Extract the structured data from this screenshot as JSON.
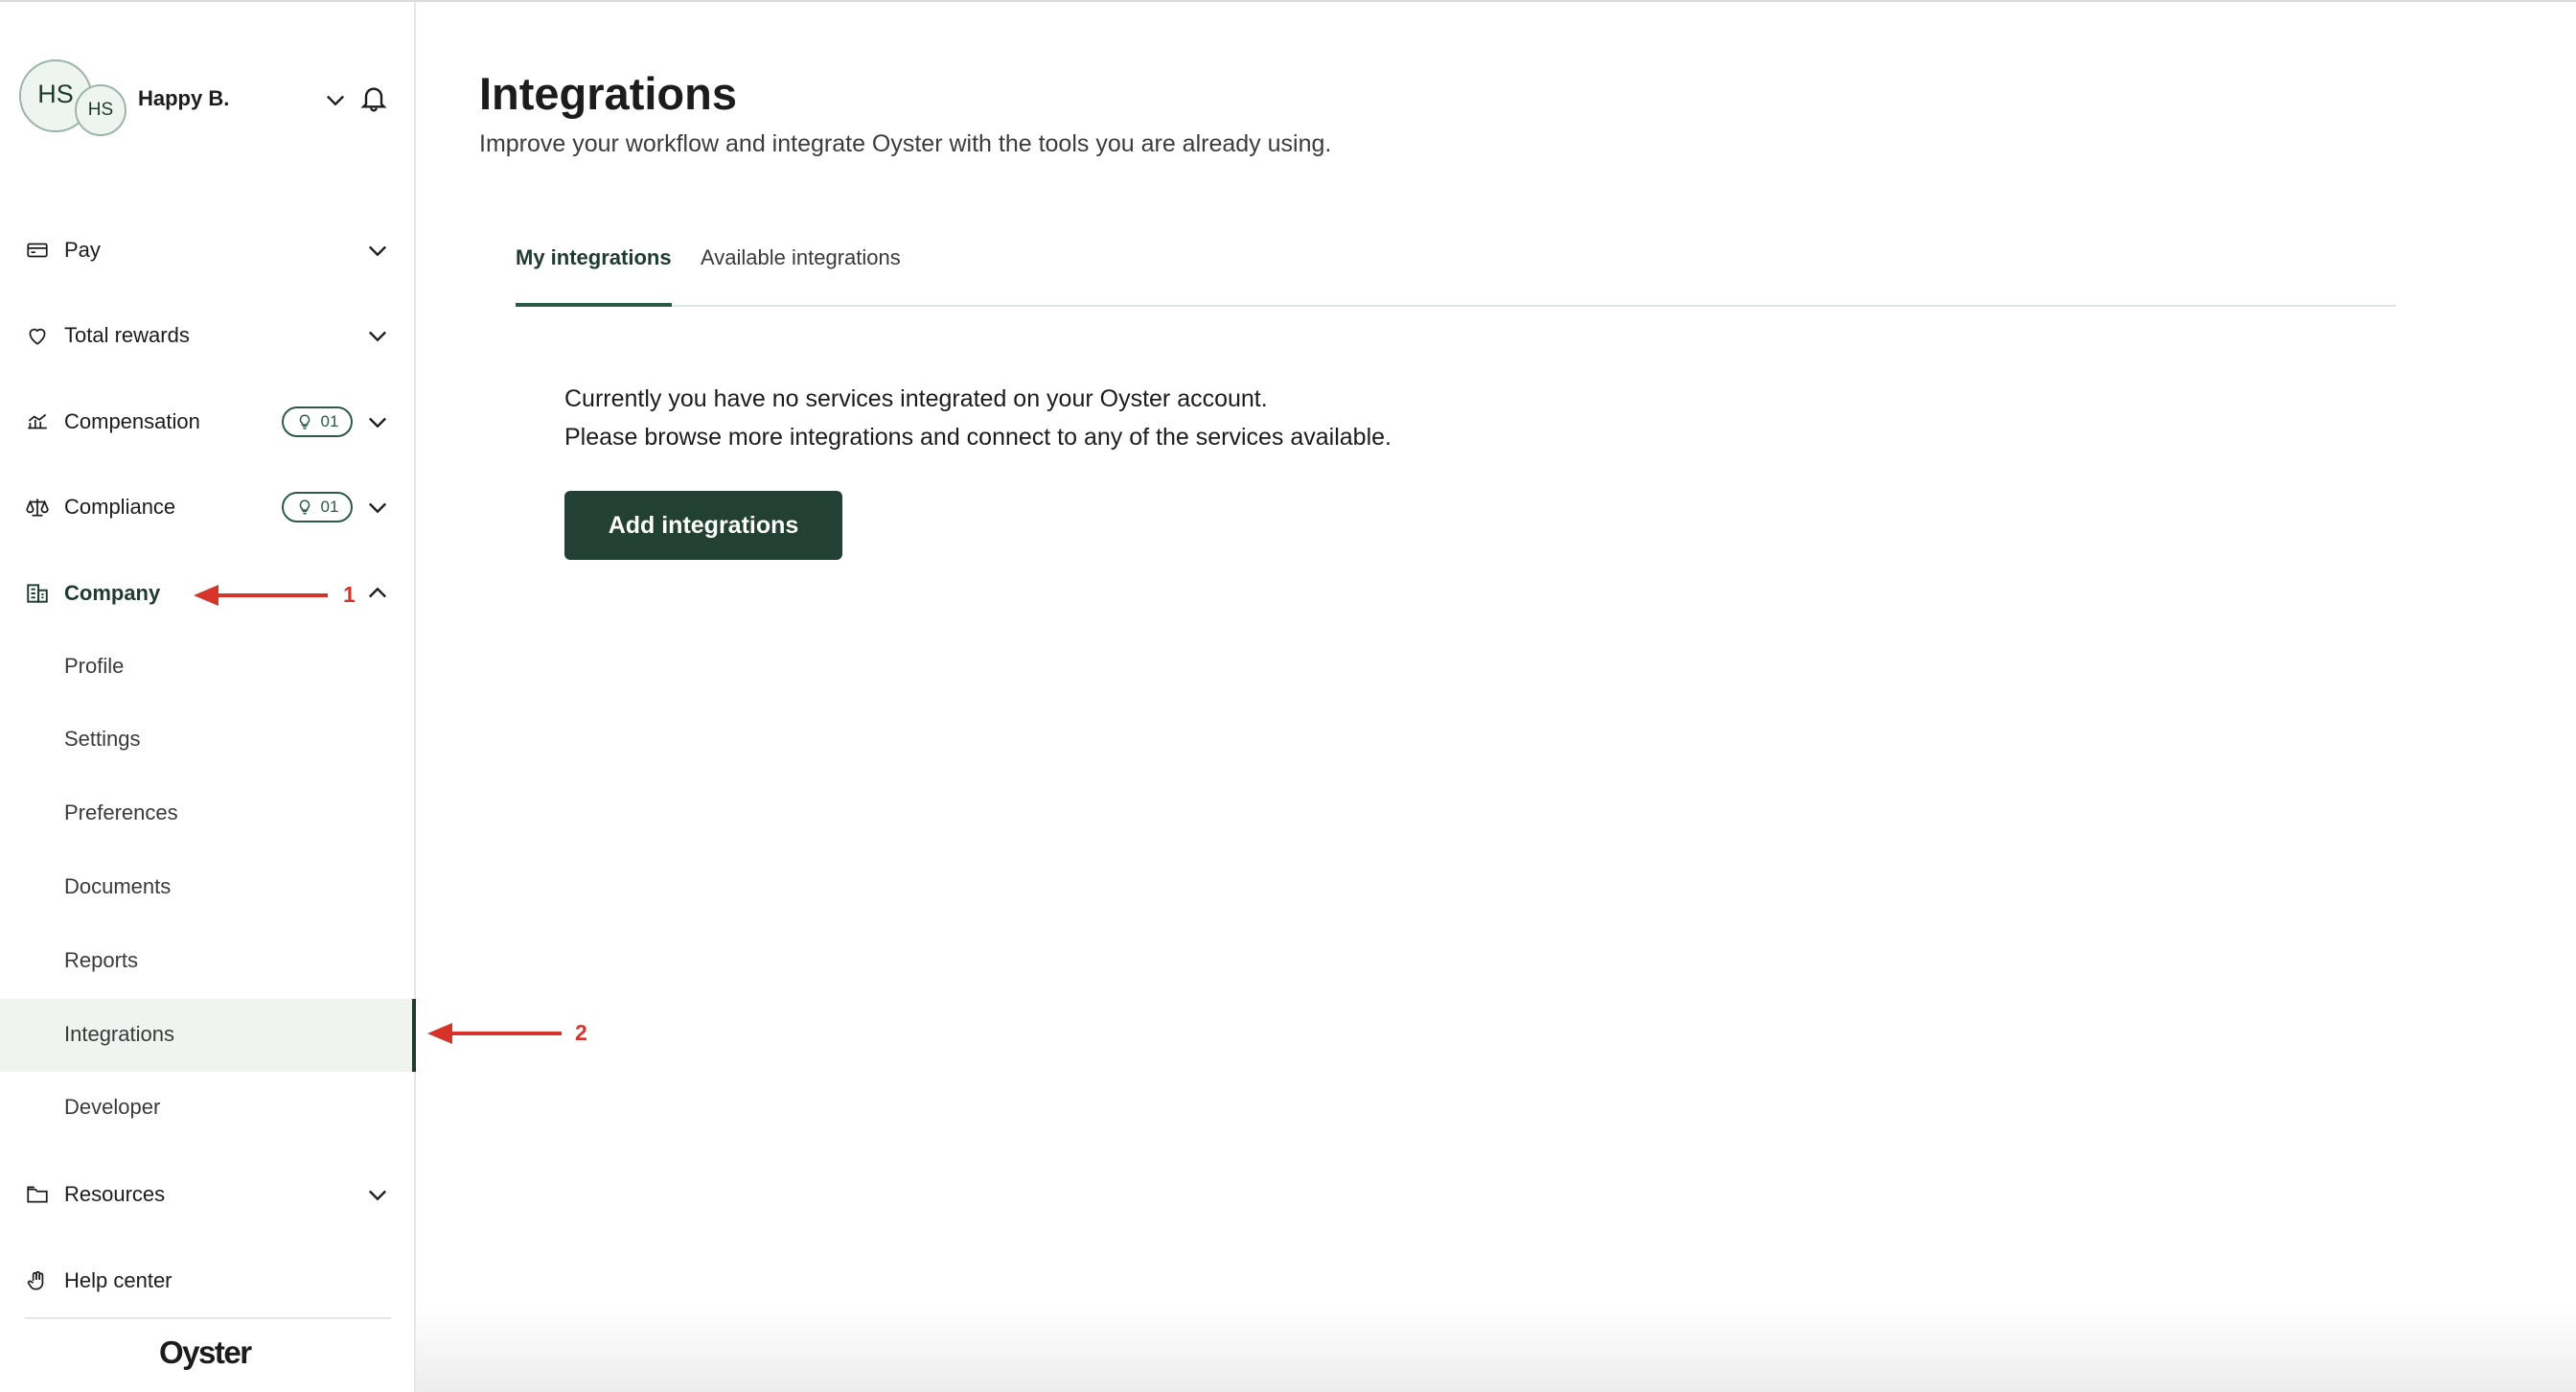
{
  "user": {
    "initials_primary": "HS",
    "initials_secondary": "HS",
    "name": "Happy B."
  },
  "nav": {
    "pay": "Pay",
    "total_rewards": "Total rewards",
    "compensation": "Compensation",
    "compensation_badge": "01",
    "compliance": "Compliance",
    "compliance_badge": "01",
    "company": "Company",
    "company_sub": [
      "Profile",
      "Settings",
      "Preferences",
      "Documents",
      "Reports",
      "Integrations",
      "Developer"
    ],
    "resources": "Resources",
    "help_center": "Help center"
  },
  "brand": {
    "logo_text": "Oyster",
    "accent": "#234034",
    "annotation_color": "#d6342b"
  },
  "page": {
    "title": "Integrations",
    "subtitle": "Improve your workflow and integrate Oyster with the tools you are already using."
  },
  "tabs": {
    "my": "My integrations",
    "available": "Available integrations"
  },
  "empty_state": {
    "line1": "Currently you have no services integrated on your Oyster account.",
    "line2": "Please browse more integrations and connect to any of the services available.",
    "button": "Add integrations"
  },
  "annotations": {
    "first": "1",
    "second": "2"
  }
}
